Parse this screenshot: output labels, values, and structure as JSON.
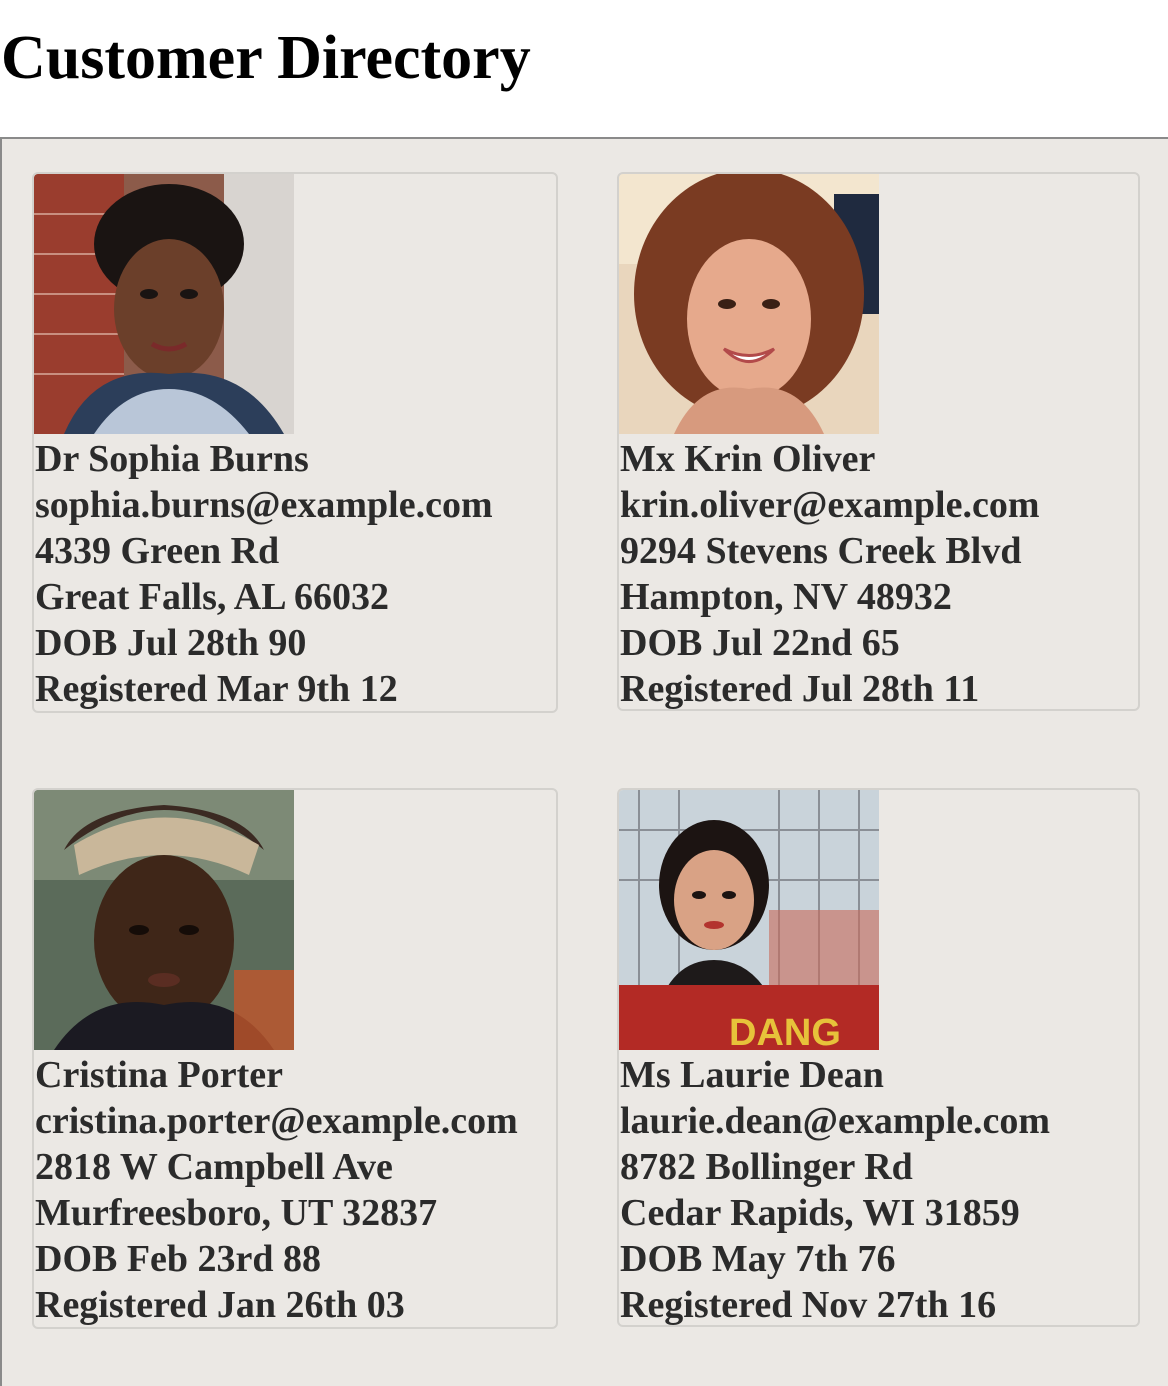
{
  "page": {
    "title": "Customer Directory"
  },
  "customers": [
    {
      "name": "Dr Sophia Burns",
      "email": "sophia.burns@example.com",
      "street": "4339 Green Rd",
      "city_line": "Great Falls, AL 66032",
      "dob": "DOB Jul 28th 90",
      "registered": "Registered Mar 9th 12"
    },
    {
      "name": "Mx Krin Oliver",
      "email": "krin.oliver@example.com",
      "street": "9294 Stevens Creek Blvd",
      "city_line": "Hampton, NV 48932",
      "dob": "DOB Jul 22nd 65",
      "registered": "Registered Jul 28th 11"
    },
    {
      "name": "Cristina Porter",
      "email": "cristina.porter@example.com",
      "street": "2818 W Campbell Ave",
      "city_line": "Murfreesboro, UT 32837",
      "dob": "DOB Feb 23rd 88",
      "registered": "Registered Jan 26th 03"
    },
    {
      "name": "Ms Laurie Dean",
      "email": "laurie.dean@example.com",
      "street": "8782 Bollinger Rd",
      "city_line": "Cedar Rapids, WI 31859",
      "dob": "DOB May 7th 76",
      "registered": "Registered Nov 27th 16"
    }
  ]
}
